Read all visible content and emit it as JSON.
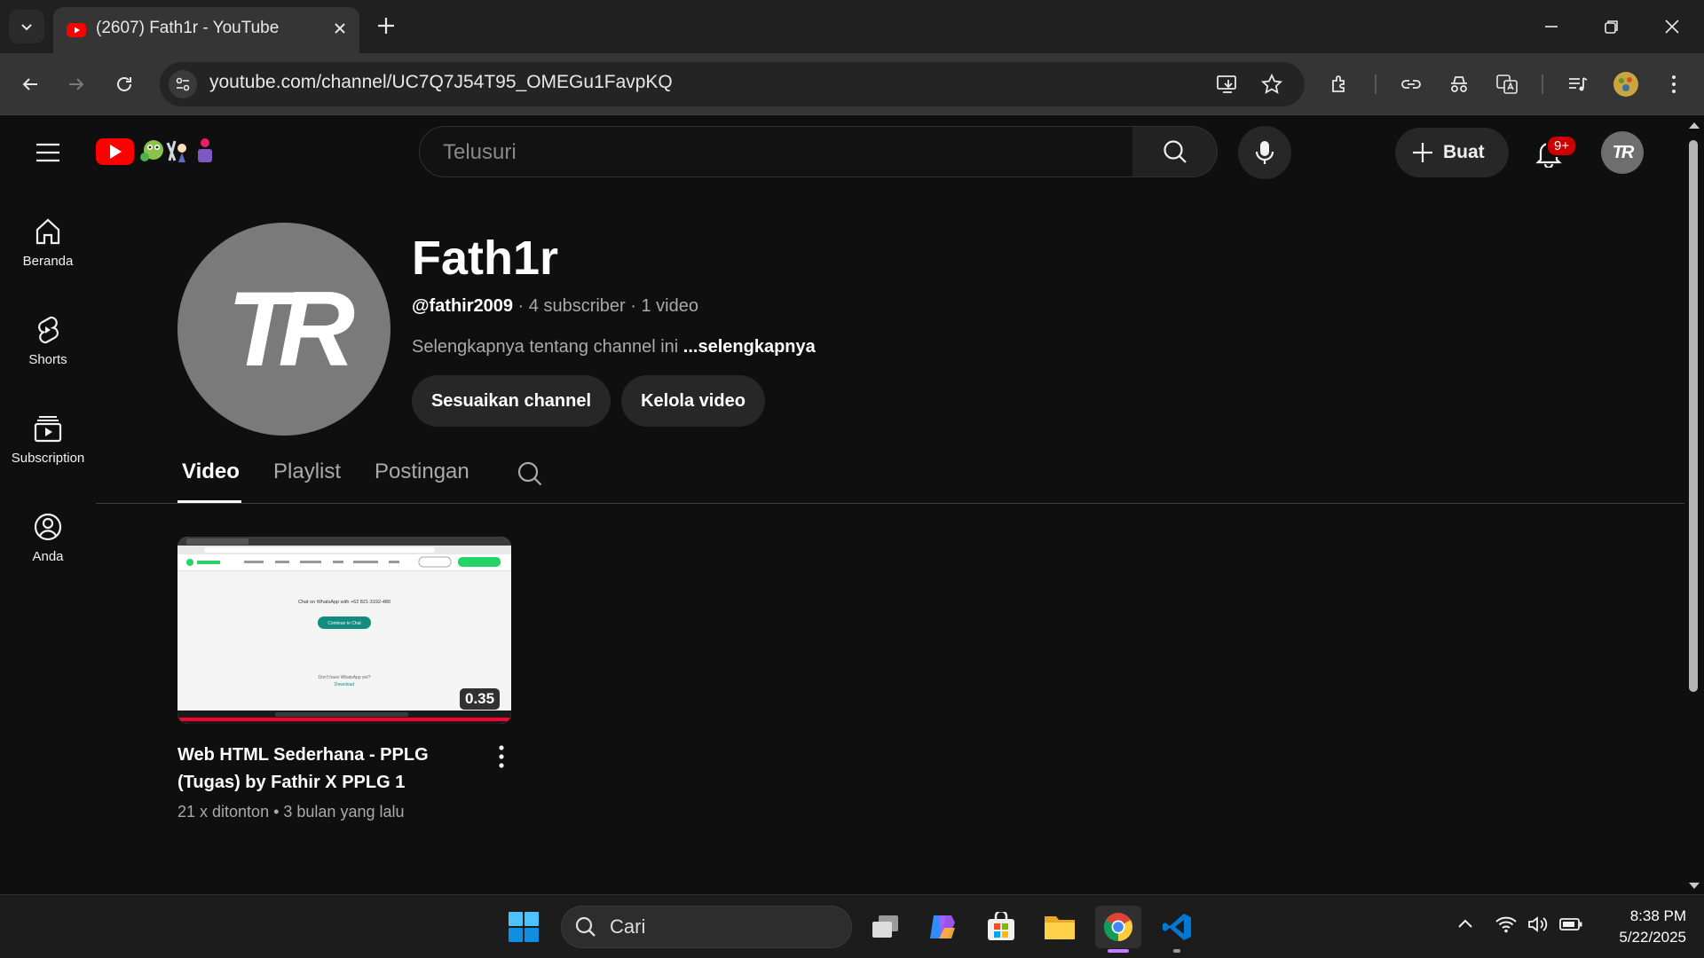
{
  "browser": {
    "tab_title": "(2607) Fath1r - YouTube",
    "url": "youtube.com/channel/UC7Q7J54T95_OMEGu1FavpKQ"
  },
  "header": {
    "search_placeholder": "Telusuri",
    "create_label": "Buat",
    "notification_badge": "9+",
    "avatar_initials": "TR"
  },
  "sidebar": {
    "items": [
      {
        "label": "Beranda",
        "icon": "home-icon"
      },
      {
        "label": "Shorts",
        "icon": "shorts-icon"
      },
      {
        "label": "Subscription",
        "icon": "subscriptions-icon"
      },
      {
        "label": "Anda",
        "icon": "you-icon"
      }
    ]
  },
  "channel": {
    "avatar_initials": "TR",
    "name": "Fath1r",
    "handle": "@fathir2009",
    "subscribers": " · 4 subscriber · 1 video",
    "description": "Selengkapnya tentang channel ini ",
    "more_link": "...selengkapnya",
    "customize_button": "Sesuaikan channel",
    "manage_button": "Kelola video"
  },
  "tabs": [
    {
      "label": "Video",
      "active": true
    },
    {
      "label": "Playlist",
      "active": false
    },
    {
      "label": "Postingan",
      "active": false
    }
  ],
  "videos": [
    {
      "title": "Web HTML Sederhana - PPLG (Tugas) by Fathir X PPLG 1",
      "duration": "0.35",
      "views": "21 x ditonton",
      "age": "3 bulan yang lalu",
      "thumb_heading": "Chat on WhatsApp with +62 821-3192-480",
      "thumb_button": "Continue to Chat",
      "thumb_footer": "Don't have WhatsApp yet?",
      "thumb_link": "Download"
    }
  ],
  "taskbar": {
    "search_placeholder": "Cari",
    "time": "8:38 PM",
    "date": "5/22/2025"
  },
  "colors": {
    "background": "#0f0f0f",
    "youtube_red": "#ff0000",
    "badge_red": "#cc0000",
    "whatsapp_green": "#25d366",
    "vscode_blue": "#0078d4"
  }
}
